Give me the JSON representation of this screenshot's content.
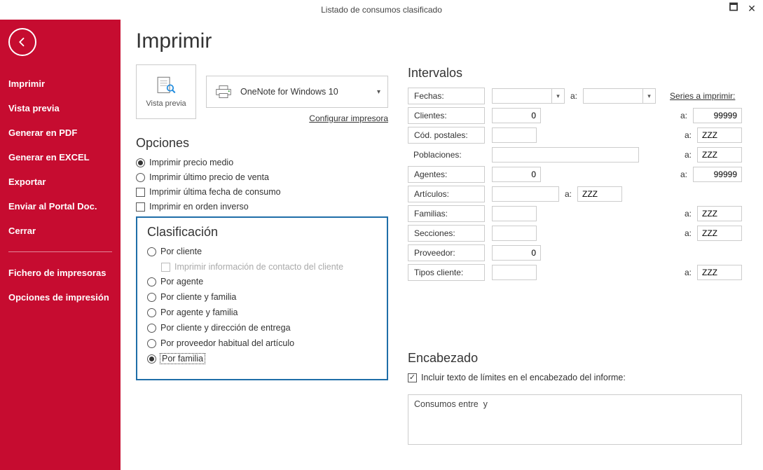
{
  "titlebar": {
    "title": "Listado de consumos clasificado"
  },
  "sidebar": {
    "items": [
      "Imprimir",
      "Vista previa",
      "Generar en PDF",
      "Generar en EXCEL",
      "Exportar",
      "Enviar al Portal Doc.",
      "Cerrar"
    ],
    "items2": [
      "Fichero de impresoras",
      "Opciones de impresión"
    ]
  },
  "page": {
    "title": "Imprimir",
    "preview_label": "Vista previa",
    "printer_name": "OneNote for Windows 10",
    "configure_link": "Configurar impresora",
    "sections": {
      "opciones": "Opciones",
      "clasificacion": "Clasificación",
      "intervalos": "Intervalos",
      "encabezado": "Encabezado"
    }
  },
  "opciones": [
    {
      "type": "radio",
      "label": "Imprimir precio medio",
      "selected": true
    },
    {
      "type": "radio",
      "label": "Imprimir último precio de venta",
      "selected": false
    },
    {
      "type": "check",
      "label": "Imprimir última fecha de consumo",
      "checked": false
    },
    {
      "type": "check",
      "label": "Imprimir en orden inverso",
      "checked": false
    }
  ],
  "clasificacion": {
    "items": [
      {
        "label": "Por cliente",
        "selected": false
      },
      {
        "label": "Por agente",
        "selected": false
      },
      {
        "label": "Por cliente y familia",
        "selected": false
      },
      {
        "label": "Por agente y familia",
        "selected": false
      },
      {
        "label": "Por cliente y dirección de entrega",
        "selected": false
      },
      {
        "label": "Por proveedor habitual del artículo",
        "selected": false
      },
      {
        "label": "Por familia",
        "selected": true
      }
    ],
    "contact_check": "Imprimir información de contacto del cliente"
  },
  "intervalos": {
    "series_link": "Series a imprimir:",
    "a": "a:",
    "rows": {
      "fechas": {
        "label": "Fechas:",
        "from": "",
        "to": ""
      },
      "clientes": {
        "label": "Clientes:",
        "from": "0",
        "to": "99999"
      },
      "codpostales": {
        "label": "Cód. postales:",
        "from": "",
        "to": "ZZZ"
      },
      "poblaciones": {
        "label": "Poblaciones:",
        "from": "",
        "to": "ZZZ"
      },
      "agentes": {
        "label": "Agentes:",
        "from": "0",
        "to": "99999"
      },
      "articulos": {
        "label": "Artículos:",
        "from": "",
        "to": "ZZZ"
      },
      "familias": {
        "label": "Familias:",
        "from": "",
        "to": "ZZZ"
      },
      "secciones": {
        "label": "Secciones:",
        "from": "",
        "to": "ZZZ"
      },
      "proveedor": {
        "label": "Proveedor:",
        "from": "0"
      },
      "tipos": {
        "label": "Tipos cliente:",
        "from": "",
        "to": "ZZZ"
      }
    }
  },
  "encabezado": {
    "check_label": "Incluir texto de límites en el encabezado del informe:",
    "text": "Consumos entre  y"
  }
}
